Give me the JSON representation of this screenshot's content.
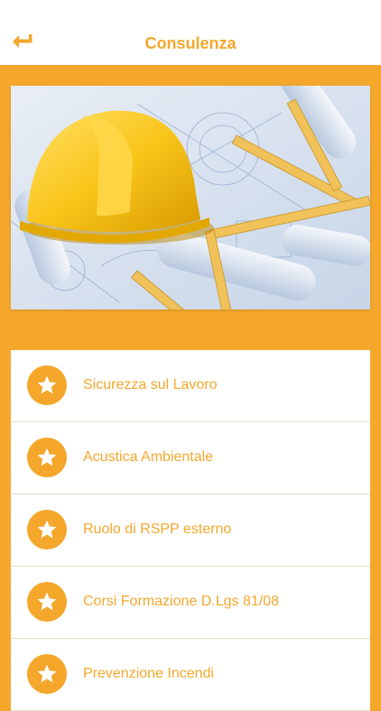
{
  "header": {
    "title": "Consulenza",
    "back_icon": "back-arrow-icon"
  },
  "hero": {
    "icon": "construction-helmet-blueprints-photo"
  },
  "menu": {
    "items": [
      {
        "label": "Sicurezza sul Lavoro",
        "icon": "star-icon"
      },
      {
        "label": "Acustica Ambientale",
        "icon": "star-icon"
      },
      {
        "label": "Ruolo di RSPP esterno",
        "icon": "star-icon"
      },
      {
        "label": "Corsi Formazione D.Lgs 81/08",
        "icon": "star-icon"
      },
      {
        "label": "Prevenzione Incendi",
        "icon": "star-icon"
      }
    ]
  },
  "colors": {
    "accent": "#f5a72c",
    "header_bg": "#ffffff",
    "list_bg": "#ffffff"
  }
}
